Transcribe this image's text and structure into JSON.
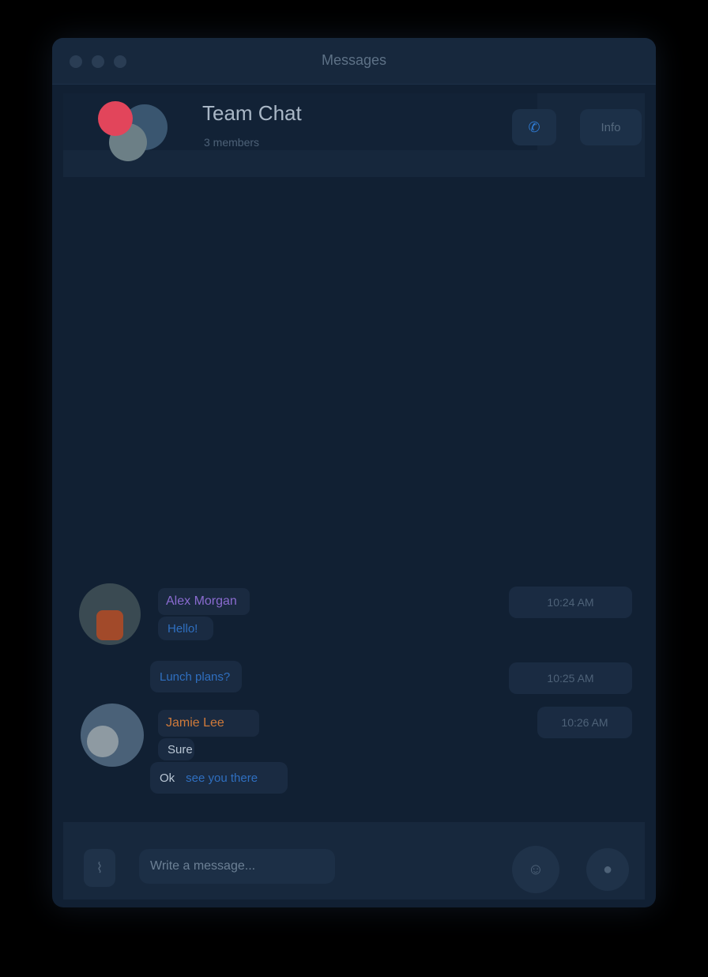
{
  "window": {
    "title": "Messages"
  },
  "chat": {
    "name": "Team Chat",
    "subtitle": "3 members",
    "header_button_label": "Info"
  },
  "messages": [
    {
      "sender": "Alex Morgan",
      "sender_color": "#8a6bd0",
      "lines": [
        "Hello!"
      ],
      "time": "10:24 AM"
    },
    {
      "sender": "",
      "lines": [
        "Lunch plans?"
      ],
      "time": "10:25 AM"
    },
    {
      "sender": "Jamie Lee",
      "sender_color": "#d07a3a",
      "lines": [
        "Sure",
        "Ok",
        "see you there"
      ],
      "time": "10:26 AM"
    }
  ],
  "composer": {
    "placeholder": "Write a message..."
  },
  "icons": {
    "header_icon": "phone-icon",
    "attach": "paperclip-icon",
    "emoji": "smile-icon",
    "send": "microphone-icon"
  }
}
